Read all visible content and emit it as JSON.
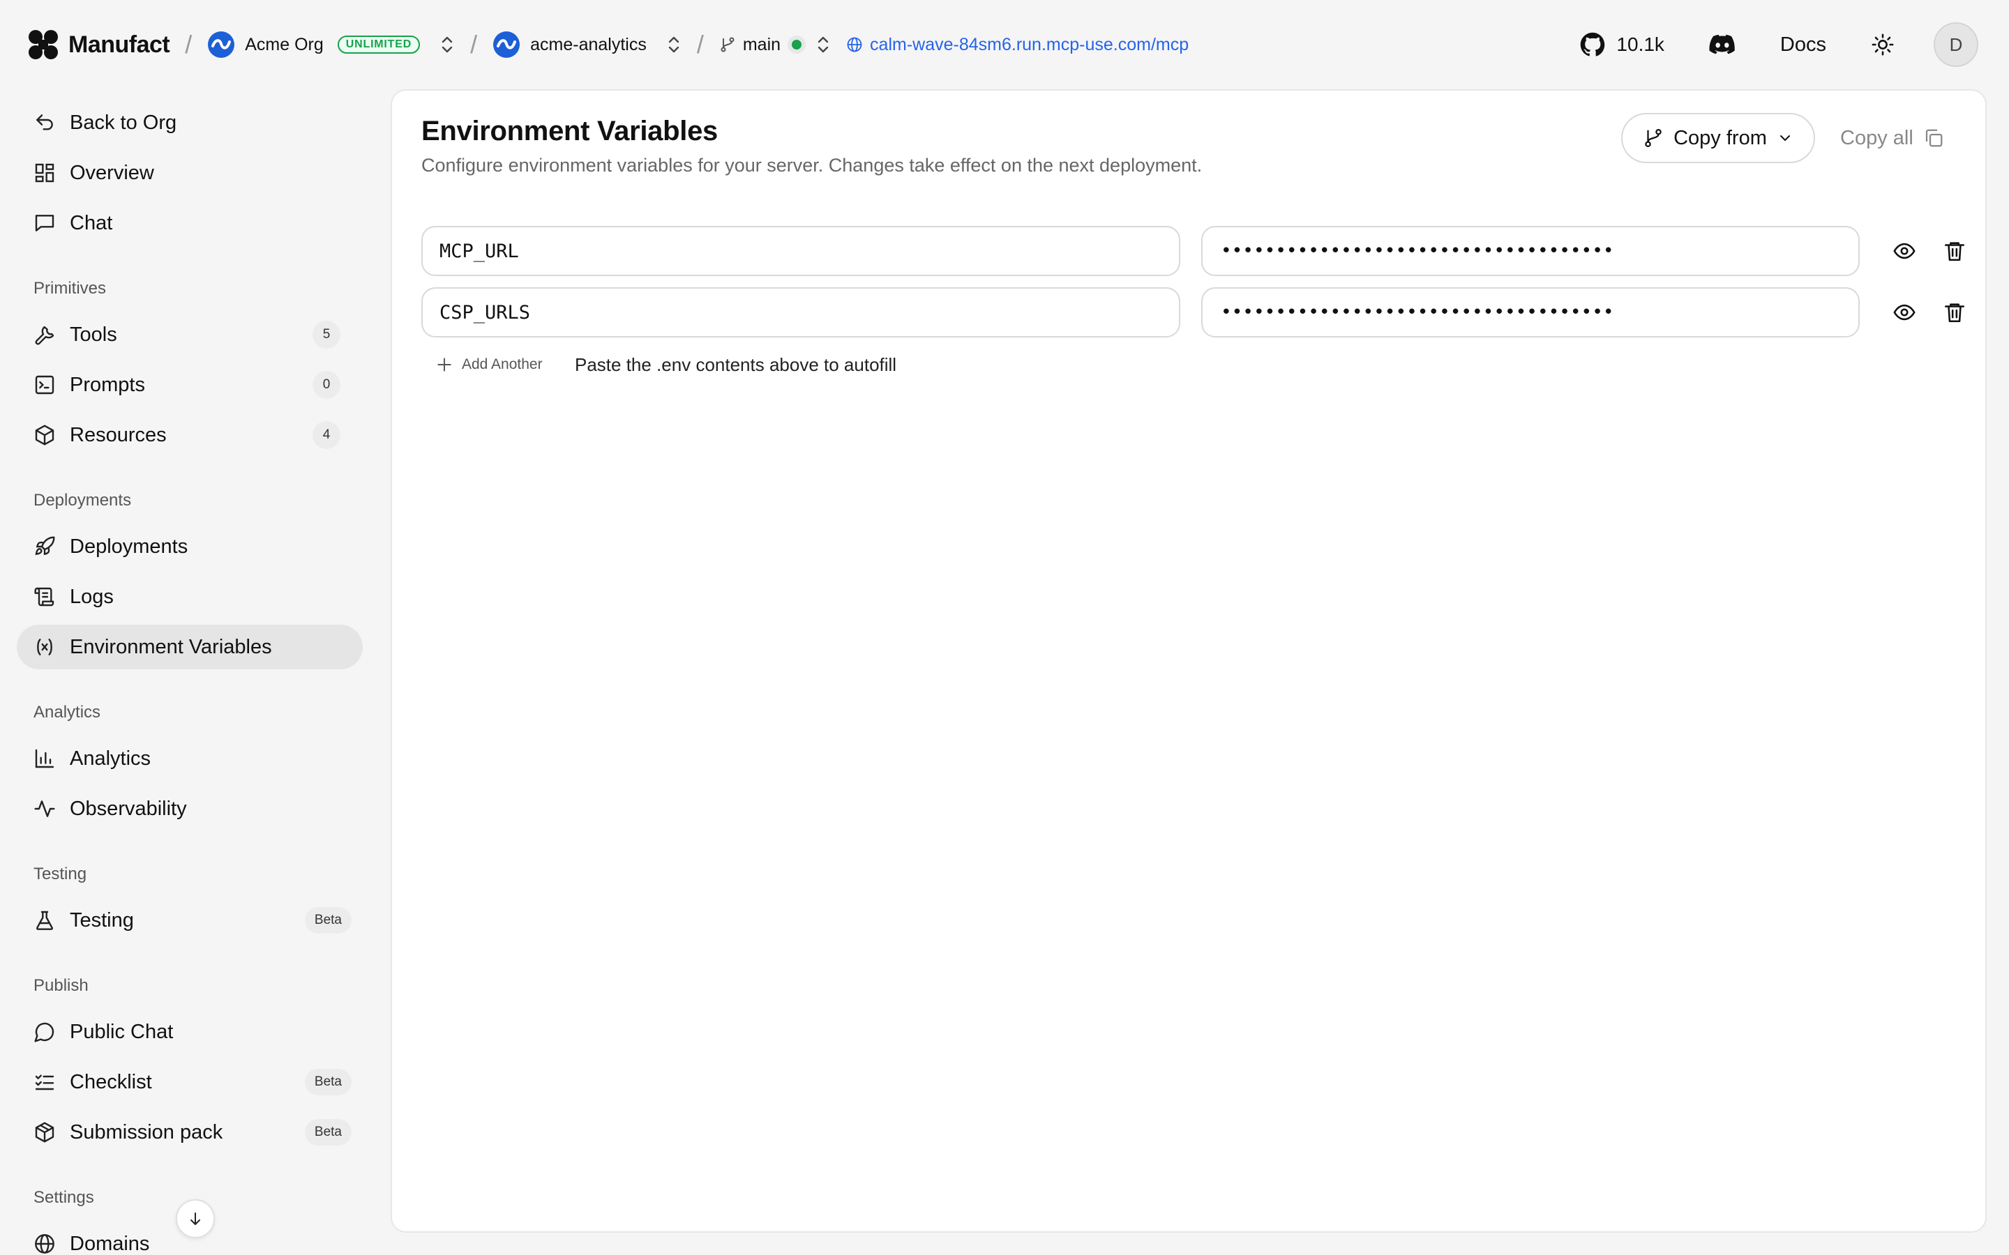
{
  "topbar": {
    "brand": "Manufact",
    "org_name": "Acme Org",
    "org_plan": "UNLIMITED",
    "project": "acme-analytics",
    "branch": "main",
    "server_url": "calm-wave-84sm6.run.mcp-use.com/mcp",
    "github_stars": "10.1k",
    "docs_label": "Docs",
    "avatar_initial": "D",
    "separator": "/"
  },
  "sidebar": {
    "back": "Back to Org",
    "overview": "Overview",
    "chat": "Chat",
    "sections": {
      "primitives": "Primitives",
      "deployments": "Deployments",
      "analytics": "Analytics",
      "testing": "Testing",
      "publish": "Publish",
      "settings": "Settings"
    },
    "tools": {
      "label": "Tools",
      "count": "5"
    },
    "prompts": {
      "label": "Prompts",
      "count": "0"
    },
    "resources": {
      "label": "Resources",
      "count": "4"
    },
    "deployments_item": "Deployments",
    "logs": "Logs",
    "env_vars": "Environment Variables",
    "analytics_item": "Analytics",
    "observability": "Observability",
    "testing_item": {
      "label": "Testing",
      "badge": "Beta"
    },
    "public_chat": "Public Chat",
    "checklist": {
      "label": "Checklist",
      "badge": "Beta"
    },
    "submission_pack": {
      "label": "Submission pack",
      "badge": "Beta"
    },
    "domains": "Domains"
  },
  "main": {
    "title": "Environment Variables",
    "description": "Configure environment variables for your server. Changes take effect on the next deployment.",
    "copy_from": "Copy from",
    "copy_all": "Copy all",
    "rows": [
      {
        "key": "MCP_URL",
        "value_masked": "••••••••••••••••••••••••••••••••••••"
      },
      {
        "key": "CSP_URLS",
        "value_masked": "••••••••••••••••••••••••••••••••••••"
      }
    ],
    "add_another": "Add Another",
    "paste_hint": "Paste the .env contents above to autofill"
  },
  "colors": {
    "accent_blue": "#2563eb",
    "plan_green": "#16a34a",
    "active_bg": "#e5e5e5"
  },
  "icons": {
    "logo": "manufact-logo-icon",
    "org": "org-wave-icon",
    "branch": "git-branch-icon",
    "url": "globe-icon",
    "github": "github-icon",
    "discord": "discord-icon",
    "theme": "sun-icon",
    "eye": "eye-icon",
    "trash": "trash-icon"
  }
}
